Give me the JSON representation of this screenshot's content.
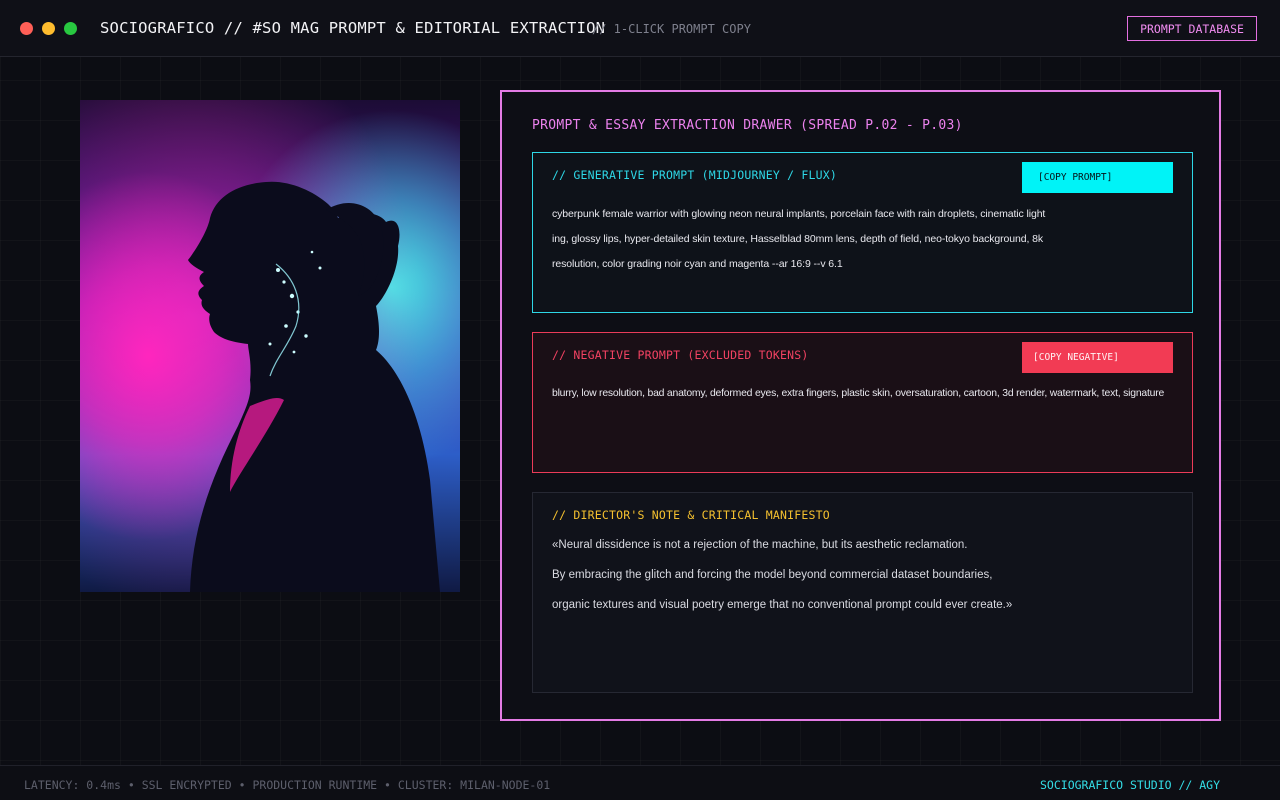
{
  "window": {
    "controls": [
      "close",
      "minimize",
      "maximize"
    ],
    "title": "SOCIOGRAFICO // #SO MAG PROMPT & EDITORIAL EXTRACTION",
    "subtitle": "// 1-CLICK PROMPT COPY",
    "database_button": "PROMPT DATABASE"
  },
  "image": {
    "subject": "neon cyberpunk woman portrait in profile with glowing neural implants"
  },
  "drawer": {
    "title": "PROMPT & ESSAY EXTRACTION DRAWER (SPREAD P.02 - P.03)",
    "generative": {
      "label": "// GENERATIVE PROMPT (MIDJOURNEY / FLUX)",
      "copy_button": "[COPY PROMPT]",
      "lines": [
        "cyberpunk female warrior with glowing neon neural implants, porcelain face with rain droplets, cinematic light",
        "ing, glossy lips, hyper-detailed skin texture, Hasselblad 80mm lens, depth of field, neo-tokyo background, 8k",
        "resolution, color grading noir cyan and magenta --ar 16:9 --v 6.1"
      ]
    },
    "negative": {
      "label": "// NEGATIVE PROMPT (EXCLUDED TOKENS)",
      "copy_button": "[COPY NEGATIVE]",
      "text": "blurry, low resolution, bad anatomy, deformed eyes, extra fingers, plastic skin, oversaturation, cartoon, 3d render, watermark, text, signature"
    },
    "note": {
      "label": "// DIRECTOR'S NOTE & CRITICAL MANIFESTO",
      "lines": [
        "«Neural dissidence is not a rejection of the machine, but its aesthetic reclamation.",
        "By embracing the glitch and forcing the model beyond commercial dataset boundaries,",
        "organic textures and visual poetry emerge that no conventional prompt could ever create.»"
      ]
    }
  },
  "footer": {
    "status": "LATENCY: 0.4ms • SSL ENCRYPTED • PRODUCTION RUNTIME • CLUSTER: MILAN-NODE-01",
    "brand": "SOCIOGRAFICO STUDIO // AGY"
  },
  "colors": {
    "magenta_accent": "#e37be4",
    "cyan_accent": "#2ed7e6",
    "red_accent": "#ea3b58",
    "yellow_accent": "#f4c02f"
  }
}
